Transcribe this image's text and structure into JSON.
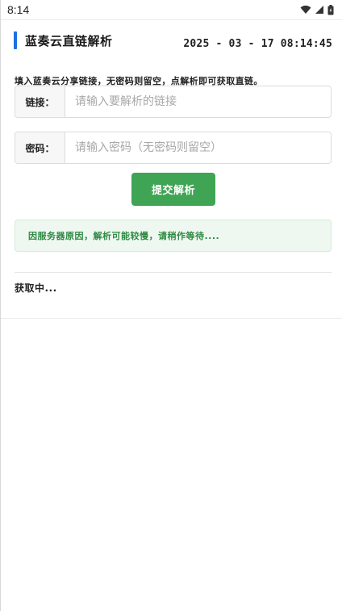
{
  "status_bar": {
    "time": "8:14",
    "icons": [
      "wifi-icon",
      "signal-icon",
      "battery-icon"
    ]
  },
  "header": {
    "title": "蓝奏云直链解析",
    "datetime": "2025 - 03 - 17 08:14:45",
    "accent_color": "#1e6fe0"
  },
  "instruction": "填入蓝奏云分享链接，无密码则留空，点解析即可获取直链。",
  "form": {
    "link": {
      "label": "链接：",
      "value": "",
      "placeholder": "请输入要解析的链接"
    },
    "password": {
      "label": "密码：",
      "value": "",
      "placeholder": "请输入密码（无密码则留空）"
    },
    "submit_label": "提交解析",
    "submit_color": "#3fa454"
  },
  "notice": {
    "text": "因服务器原因，解析可能较慢，请稍作等待....",
    "color": "#2e8a43",
    "background": "#eef8f0"
  },
  "result": {
    "text": "获取中..."
  }
}
